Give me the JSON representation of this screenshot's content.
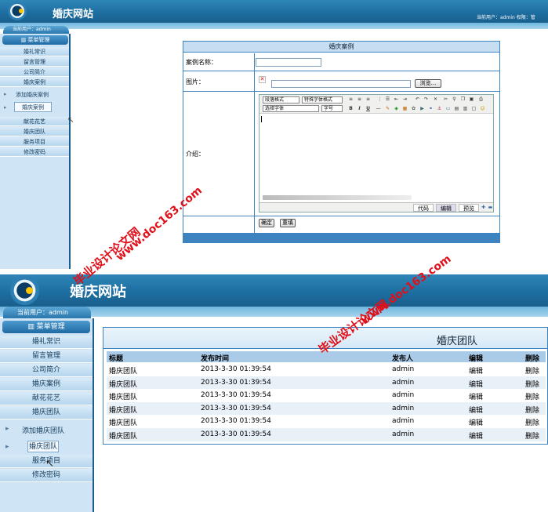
{
  "app": {
    "site_title": "婚庆网站",
    "current_user_label": "当前用户：admin",
    "top_right_user": "当前用户：admin  权限：管"
  },
  "sidebar": {
    "section_title": "菜单管理",
    "items": [
      "婚礼常识",
      "留言管理",
      "公司简介",
      "婚庆案例"
    ],
    "items_after": [
      "献花花艺",
      "婚庆团队",
      "服务项目",
      "修改密码"
    ],
    "tree_items": [
      "添加婚庆案例",
      "婚庆案例"
    ]
  },
  "sidebar2": {
    "section_title": "菜单管理",
    "items": [
      "婚礼常识",
      "留言管理",
      "公司简介",
      "婚庆案例",
      "献花花艺",
      "婚庆团队"
    ],
    "tree_items": [
      "添加婚庆团队",
      "婚庆团队"
    ],
    "items_after": [
      "服务项目",
      "修改密码"
    ]
  },
  "form": {
    "title": "婚庆案例",
    "name_label": "案例名称：",
    "image_label": "图片：",
    "browse_button": "浏览...",
    "intro_label": "介绍：",
    "editor": {
      "format_select": "段落格式",
      "special_format_select": "特殊字体格式",
      "font_select": "选择字体",
      "size_select": "字号",
      "tabs": [
        "代码",
        "编辑",
        "预览"
      ]
    },
    "confirm_button": "确定",
    "reset_button": "重填"
  },
  "table": {
    "title": "婚庆团队",
    "columns": [
      "标题",
      "发布时间",
      "发布人",
      "编辑",
      "删除"
    ],
    "rows": [
      [
        "婚庆团队",
        "2013-3-30 01:39:54",
        "admin",
        "编辑",
        "删除"
      ],
      [
        "婚庆团队",
        "2013-3-30 01:39:54",
        "admin",
        "编辑",
        "删除"
      ],
      [
        "婚庆团队",
        "2013-3-30 01:39:54",
        "admin",
        "编辑",
        "删除"
      ],
      [
        "婚庆团队",
        "2013-3-30 01:39:54",
        "admin",
        "编辑",
        "删除"
      ],
      [
        "婚庆团队",
        "2013-3-30 01:39:54",
        "admin",
        "编辑",
        "删除"
      ],
      [
        "婚庆团队",
        "2013-3-30 01:39:54",
        "admin",
        "编辑",
        "删除"
      ]
    ]
  },
  "watermarks": {
    "site_name": "毕业设计论文网",
    "url": "www.doc163.com"
  },
  "colors": {
    "header_blue": "#1d6ea1",
    "accent_blue": "#3c83bf",
    "watermark_red": "#e0101a"
  }
}
